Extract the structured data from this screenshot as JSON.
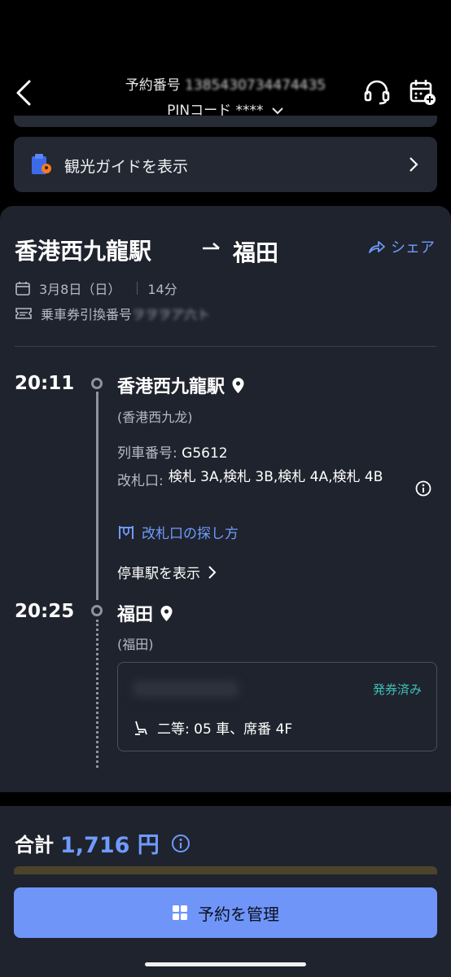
{
  "header": {
    "booking_label": "予約番号",
    "booking_number": "1385430734474435",
    "pin_label": "PINコード",
    "pin_value": "****"
  },
  "guide": {
    "label": "観光ガイドを表示"
  },
  "route": {
    "from": "香港西九龍駅",
    "to": "福田",
    "share_label": "シェア",
    "date": "3月8日（日）",
    "duration": "14分",
    "ticket_pickup_label": "乗車券引換番号",
    "ticket_pickup_value": "ヲヲヲア六ト"
  },
  "departure": {
    "time": "20:11",
    "station": "香港西九龍駅",
    "station_cn": "(香港西九龙)",
    "train_label": "列車番号:",
    "train_number": "G5612",
    "gate_label": "改札口:",
    "gates": "検札 3A,検札 3B,検札 4A,検札 4B",
    "howto_label": "改札口の探し方",
    "stops_label": "停車駅を表示"
  },
  "arrival": {
    "time": "20:25",
    "station": "福田",
    "station_cn": "(福田)"
  },
  "ticket": {
    "status": "発券済み",
    "seat": "二等: 05 車、席番 4F"
  },
  "total": {
    "label": "合計",
    "value": "1,716 円"
  },
  "manage_label": "予約を管理",
  "colors": {
    "accent": "#6f9bff",
    "issued": "#3fc1b8",
    "guide_icon": "#3d6be8",
    "guide_pin": "#ff7a1a"
  }
}
